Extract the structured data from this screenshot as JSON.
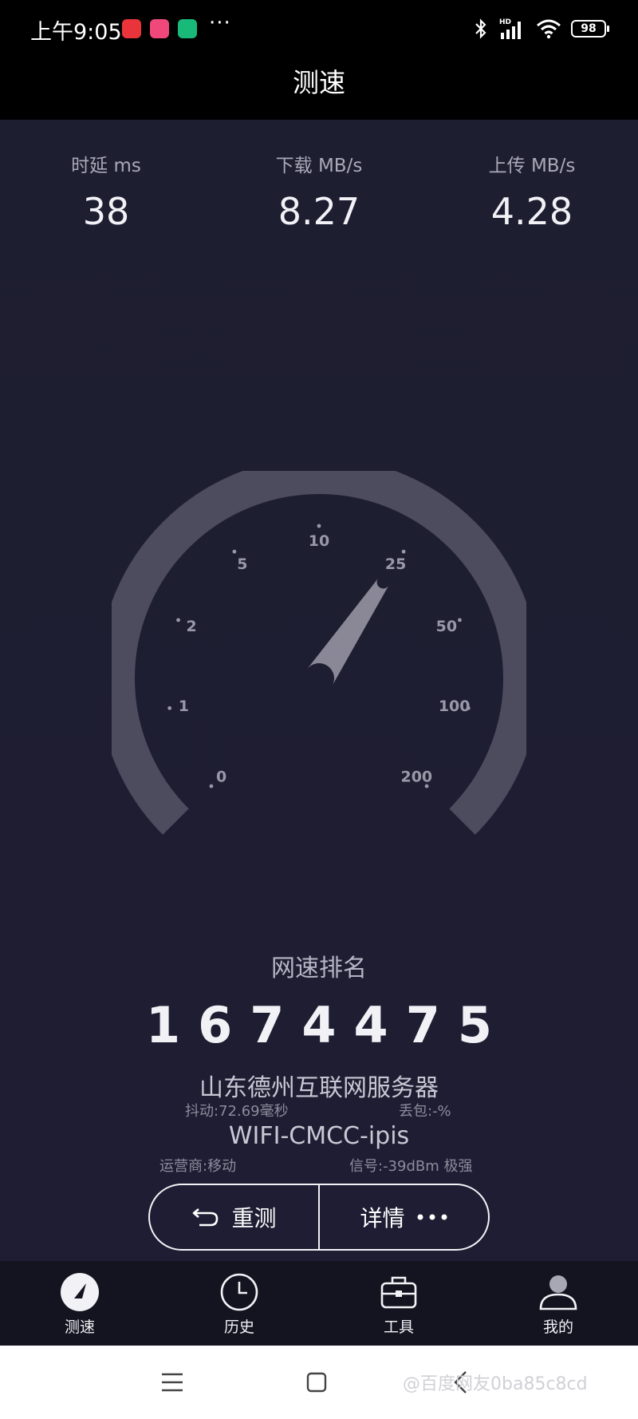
{
  "status_bar": {
    "time": "上午9:05",
    "more": "···",
    "bluetooth_icon": "bluetooth-icon",
    "hd": "HD",
    "battery": "98",
    "app_icons": [
      "red-app-icon",
      "pink-app-icon",
      "green-shield-app-icon"
    ]
  },
  "header": {
    "title": "测速"
  },
  "metrics": [
    {
      "label": "时延 ms",
      "value": "38"
    },
    {
      "label": "下载 MB/s",
      "value": "8.27"
    },
    {
      "label": "上传 MB/s",
      "value": "4.28"
    }
  ],
  "gauge": {
    "ticks": [
      "0",
      "1",
      "2",
      "5",
      "10",
      "25",
      "50",
      "100",
      "200"
    ],
    "needle_value": "25"
  },
  "ranking": {
    "label": "网速排名",
    "value": "1674475"
  },
  "server": {
    "name": "山东德州互联网服务器",
    "jitter": "抖动:72.69毫秒",
    "packet_loss": "丢包:-%"
  },
  "network": {
    "name": "WIFI-CMCC-ipis",
    "operator": "运营商:移动",
    "signal": "信号:-39dBm 极强"
  },
  "actions": {
    "retest": "重测",
    "details": "详情"
  },
  "tabs": [
    {
      "label": "测速",
      "icon": "speedometer-icon"
    },
    {
      "label": "历史",
      "icon": "clock-icon"
    },
    {
      "label": "工具",
      "icon": "toolbox-icon"
    },
    {
      "label": "我的",
      "icon": "user-icon"
    }
  ],
  "watermark": "@百度网友0ba85c8cd",
  "colors": {
    "background": "#1e1d30",
    "gauge_track": "#4d4b5e",
    "needle": "#8a8896",
    "tab_bar": "#141421"
  }
}
